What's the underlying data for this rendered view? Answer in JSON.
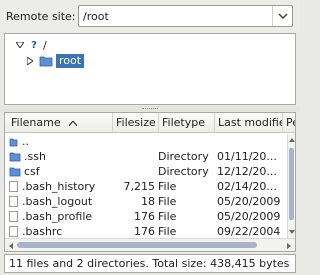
{
  "remote": {
    "label": "Remote site:",
    "path": "/root"
  },
  "tree": {
    "root_label": "/",
    "child_label": "root"
  },
  "list": {
    "columns": [
      "Filename",
      "Filesize",
      "Filetype",
      "Last modified",
      "Pe"
    ],
    "sort_indicator": "^",
    "rows": [
      {
        "name": "..",
        "size": "",
        "type": "",
        "modified": "",
        "kind": "updir"
      },
      {
        "name": ".ssh",
        "size": "",
        "type": "Directory",
        "modified": "01/11/20...",
        "kind": "dir"
      },
      {
        "name": "csf",
        "size": "",
        "type": "Directory",
        "modified": "12/12/20...",
        "kind": "dir"
      },
      {
        "name": ".bash_history",
        "size": "7,215",
        "type": "File",
        "modified": "02/14/20...",
        "kind": "file"
      },
      {
        "name": ".bash_logout",
        "size": "18",
        "type": "File",
        "modified": "05/20/2009",
        "kind": "file"
      },
      {
        "name": ".bash_profile",
        "size": "176",
        "type": "File",
        "modified": "05/20/2009",
        "kind": "file"
      },
      {
        "name": ".bashrc",
        "size": "176",
        "type": "File",
        "modified": "09/22/2004",
        "kind": "file"
      }
    ]
  },
  "status": {
    "text": "11 files and 2 directories. Total size: 438,415 bytes"
  },
  "colors": {
    "selection": "#3d74b8",
    "folder": "#5b8fd6"
  },
  "icons": [
    "folder-icon",
    "question-icon",
    "file-icon",
    "chevron-down-icon"
  ]
}
